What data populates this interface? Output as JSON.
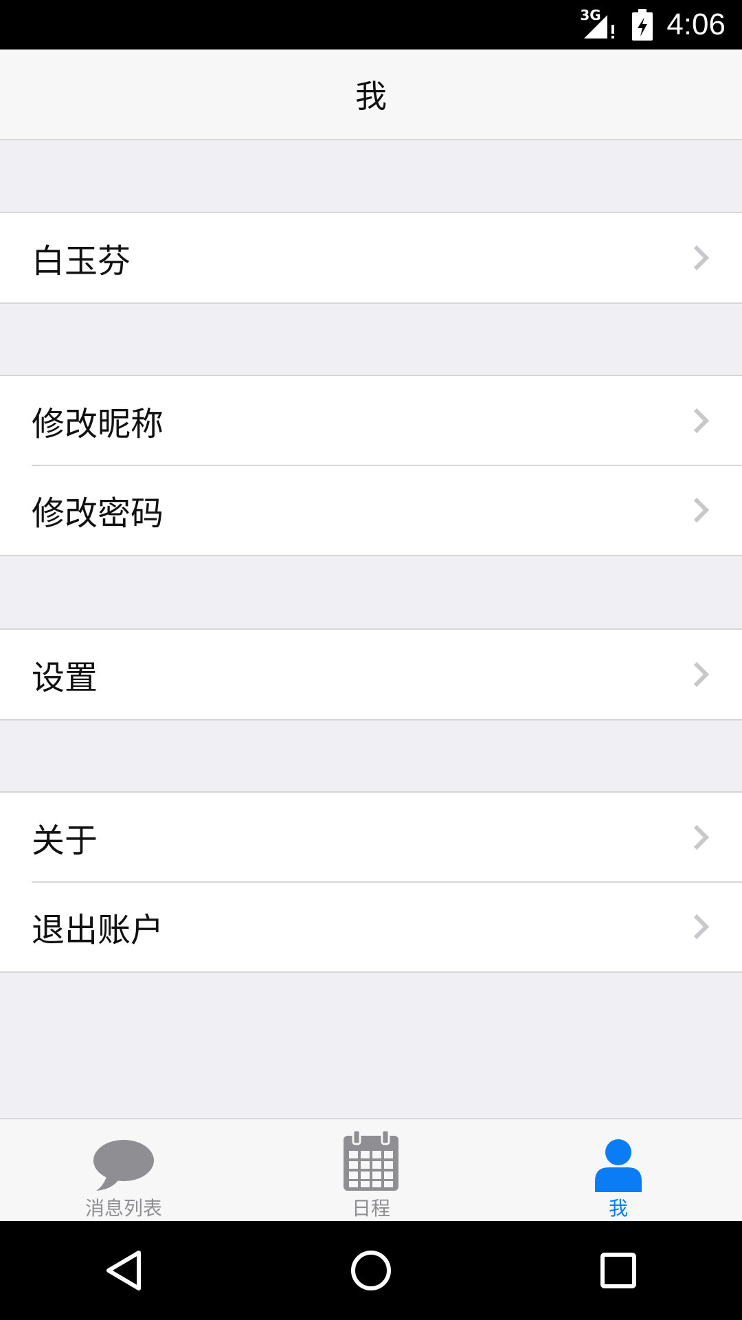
{
  "status_bar": {
    "network": "3G",
    "time": "4:06",
    "icons": [
      "signal-icon",
      "battery-charging-icon"
    ]
  },
  "header": {
    "title": "我"
  },
  "groups": [
    {
      "items": [
        {
          "label": "白玉芬",
          "icon": "chevron-right-icon"
        }
      ]
    },
    {
      "items": [
        {
          "label": "修改昵称",
          "icon": "chevron-right-icon"
        },
        {
          "label": "修改密码",
          "icon": "chevron-right-icon"
        }
      ]
    },
    {
      "items": [
        {
          "label": "设置",
          "icon": "chevron-right-icon"
        }
      ]
    },
    {
      "items": [
        {
          "label": "关于",
          "icon": "chevron-right-icon"
        },
        {
          "label": "退出账户",
          "icon": "chevron-right-icon"
        }
      ]
    }
  ],
  "tab_bar": {
    "tabs": [
      {
        "label": "消息列表",
        "icon": "chat-bubble-icon",
        "active": false
      },
      {
        "label": "日程",
        "icon": "calendar-icon",
        "active": false
      },
      {
        "label": "我",
        "icon": "person-icon",
        "active": true
      }
    ]
  },
  "nav_bar": {
    "buttons": [
      "back-icon",
      "home-icon",
      "recents-icon"
    ]
  },
  "colors": {
    "accent": "#0a7cf5",
    "inactive_tab": "#8e8e93",
    "background": "#efeff4",
    "chevron": "#c7c7cc"
  }
}
